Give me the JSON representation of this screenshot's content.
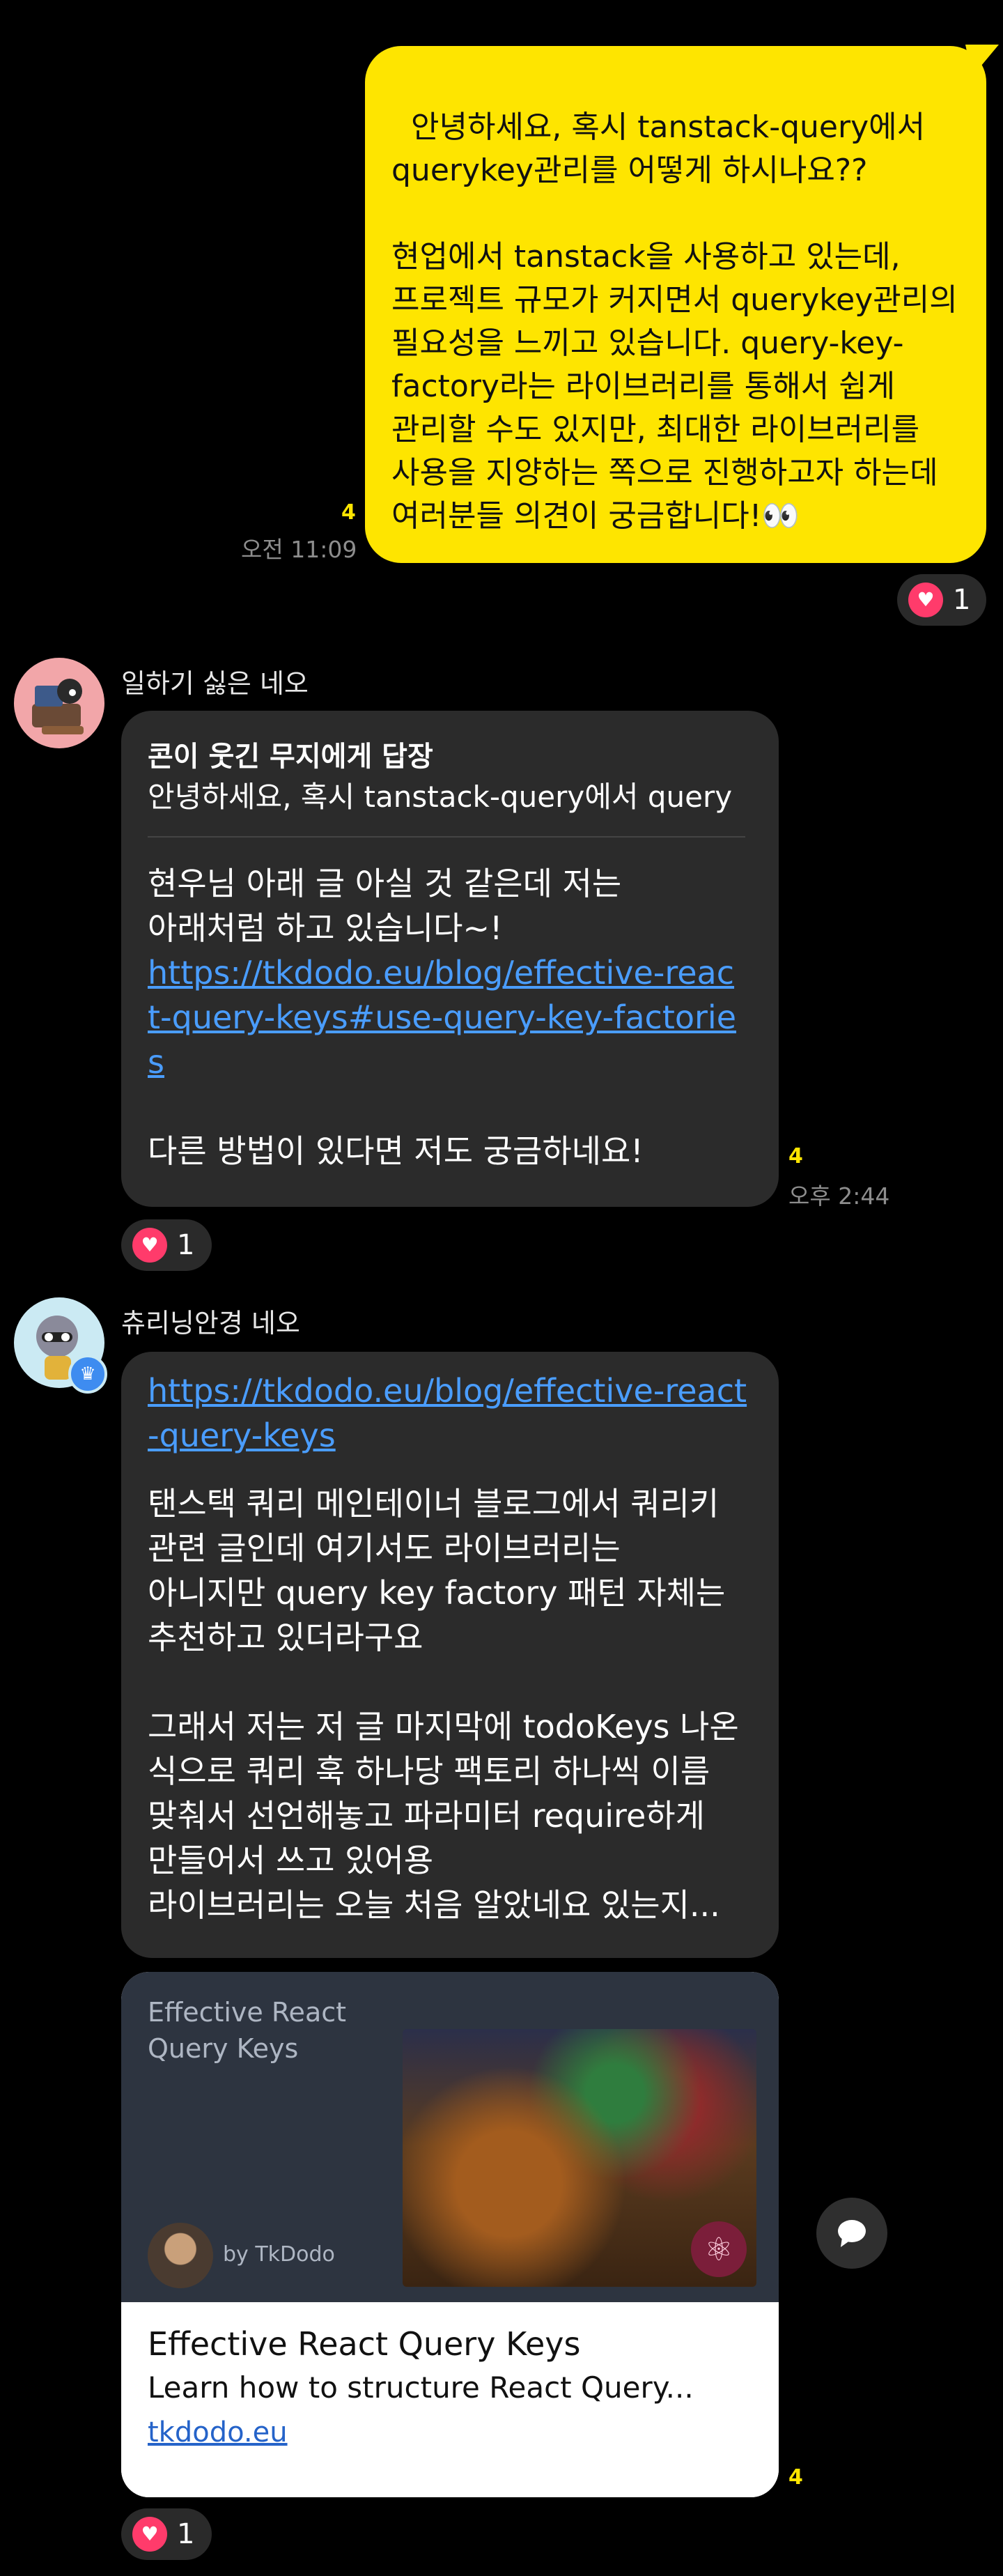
{
  "my_message": {
    "text": "안녕하세요, 혹시 tanstack-query에서 querykey관리를 어떻게 하시나요??\n\n현업에서 tanstack을 사용하고 있는데, 프로젝트 규모가 커지면서 querykey관리의 필요성을 느끼고 있습니다. query-key-factory라는 라이브러리를 통해서 쉽게 관리할 수도 있지만, 최대한 라이브러리를 사용을 지양하는 쪽으로 진행하고자 하는데 여러분들 의견이 궁금합니다!👀",
    "unread": "4",
    "time": "오전 11:09",
    "reaction_count": "1",
    "accent": "#fee500"
  },
  "msg1": {
    "sender": "일하기 싫은 네오",
    "reply_to": "콘이 웃긴 무지에게 답장",
    "reply_quote": "안녕하세요, 혹시 tanstack-query에서 query",
    "body_before": "현우님 아래 글 아실 것 같은데 저는 아래처럼 하고 있습니다~!",
    "link": "https://tkdodo.eu/blog/effective-react-query-keys#use-query-key-factories",
    "body_after": "다른 방법이 있다면 저도 궁금하네요!",
    "unread": "4",
    "time": "오후 2:44",
    "reaction_count": "1"
  },
  "msg2": {
    "sender": "츄리닝안경 네오",
    "link": "https://tkdodo.eu/blog/effective-react-query-keys",
    "para1": "탠스택 쿼리 메인테이너 블로그에서 쿼리키 관련 글인데 여기서도 라이브러리는 아니지만 query key factory 패턴 자체는 추천하고 있더라구요",
    "para2": "그래서 저는 저 글 마지막에 todoKeys 나온 식으로 쿼리 훅 하나당 팩토리 하나씩 이름 맞춰서 선언해놓고 파라미터 require하게 만들어서 쓰고 있어용",
    "para3": "라이브러리는 오늘 처음 알았네요 있는지...",
    "card": {
      "site_title": "Effective React Query Keys",
      "author": "by TkDodo",
      "title": "Effective React Query Keys",
      "description": "Learn how to structure React Query...",
      "domain": "tkdodo.eu"
    },
    "unread": "4",
    "reaction_count": "1"
  },
  "icons": {
    "heart": "heart-icon",
    "share": "speech-bubble-icon"
  },
  "colors": {
    "background": "#000000",
    "bubble_dark": "#2b2b2b",
    "link": "#4a9dff",
    "heart": "#ff3b6b"
  }
}
